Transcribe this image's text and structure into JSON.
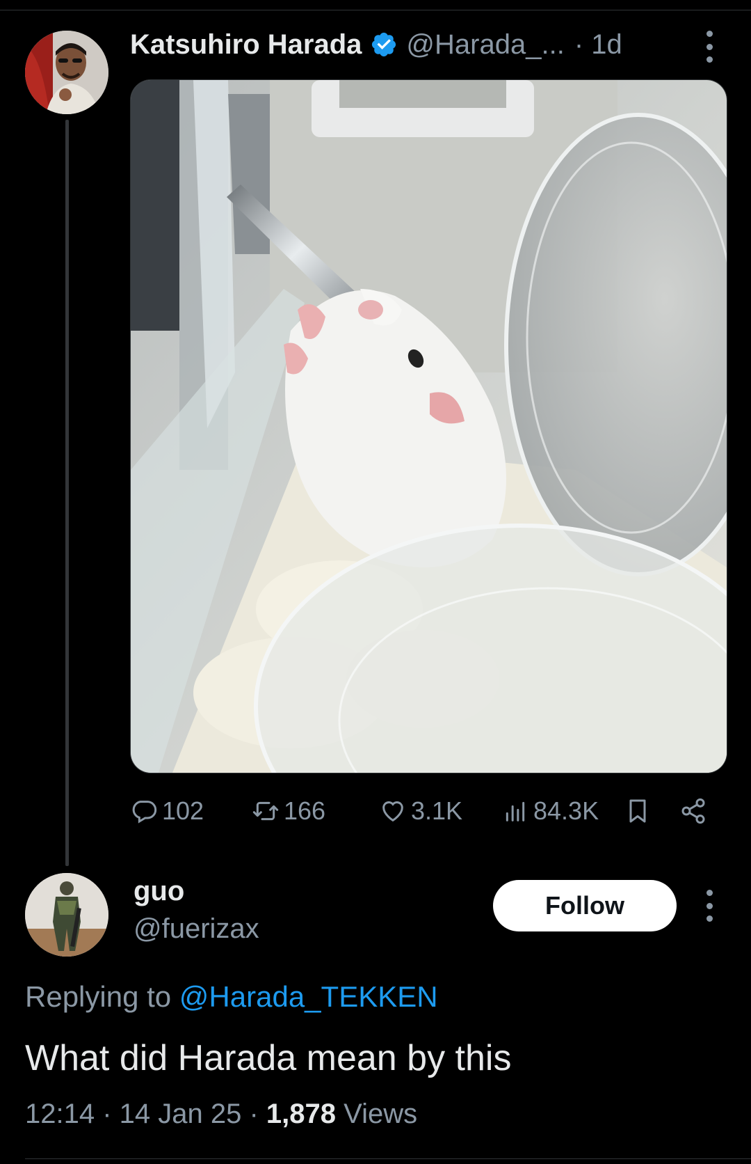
{
  "tweet": {
    "author_name": "Katsuhiro Harada",
    "handle": "@Harada_...",
    "time": "· 1d",
    "verified_icon": "verified-badge-icon",
    "image_alt": "white hamster drinking from water bottle",
    "stats": {
      "replies": "102",
      "retweets": "166",
      "likes": "3.1K",
      "views": "84.3K"
    }
  },
  "reply": {
    "author_name": "guo",
    "handle": "@fuerizax",
    "follow_label": "Follow",
    "replying_prefix": "Replying to ",
    "replying_handle": "@Harada_TEKKEN",
    "text": "What did Harada mean by this",
    "time": "12:14",
    "sep1": " · ",
    "date": "14 Jan 25",
    "sep2": " · ",
    "views_count": "1,878",
    "views_label": " Views"
  },
  "colors": {
    "background": "#000000",
    "text_primary": "#e7e9ea",
    "text_secondary": "#8b98a5",
    "accent": "#1d9bf0"
  }
}
